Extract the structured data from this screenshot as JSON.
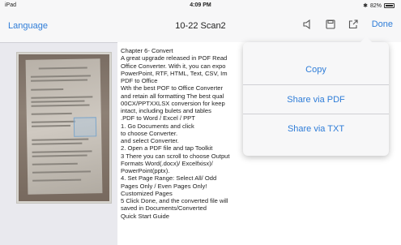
{
  "status_bar": {
    "carrier": "iPad",
    "time": "4:09 PM",
    "battery_text": "82%"
  },
  "nav": {
    "back_label": "Language",
    "title": "10-22 Scan2",
    "done_label": "Done",
    "icons": [
      "speaker-icon",
      "save-icon",
      "share-icon"
    ]
  },
  "document": {
    "lines": [
      "Chapter 6- Convert",
      "A great upgrade released in POF Read",
      "Office Converter. With it, you can expo",
      "PowerPoint, RTF, HTML, Text, CSV, Im",
      "PDF to Office",
      "Wth the best POF to Office Converter",
      "and retain all formatting The best qual",
      "00CX/PPTXXLSX conversion for keep",
      "intact, including bulets and tables",
      ".PDF to Word / Excel / PPT",
      "1. Go Documents and click",
      "to choose Converter.",
      "and select Converter.",
      "2. Open a PDF file and tap Toolkit",
      "3 There you can scroll to choose Output",
      "Formats Word(.docx)/ Excelfxisx)/",
      "PowerPoint(pptx).",
      "4. Set Page Range: Select All/ Odd",
      "Pages Only / Even Pages Only!",
      "Customized Pages",
      "5 Click Done, and the converted file will",
      "saved in Documents/Converted",
      "Quick Start Guide"
    ]
  },
  "share_menu": {
    "items": [
      "Copy",
      "Share via PDF",
      "Share via TXT"
    ]
  },
  "colors": {
    "accent": "#2f7dd8",
    "background": "#e9e9ee"
  }
}
